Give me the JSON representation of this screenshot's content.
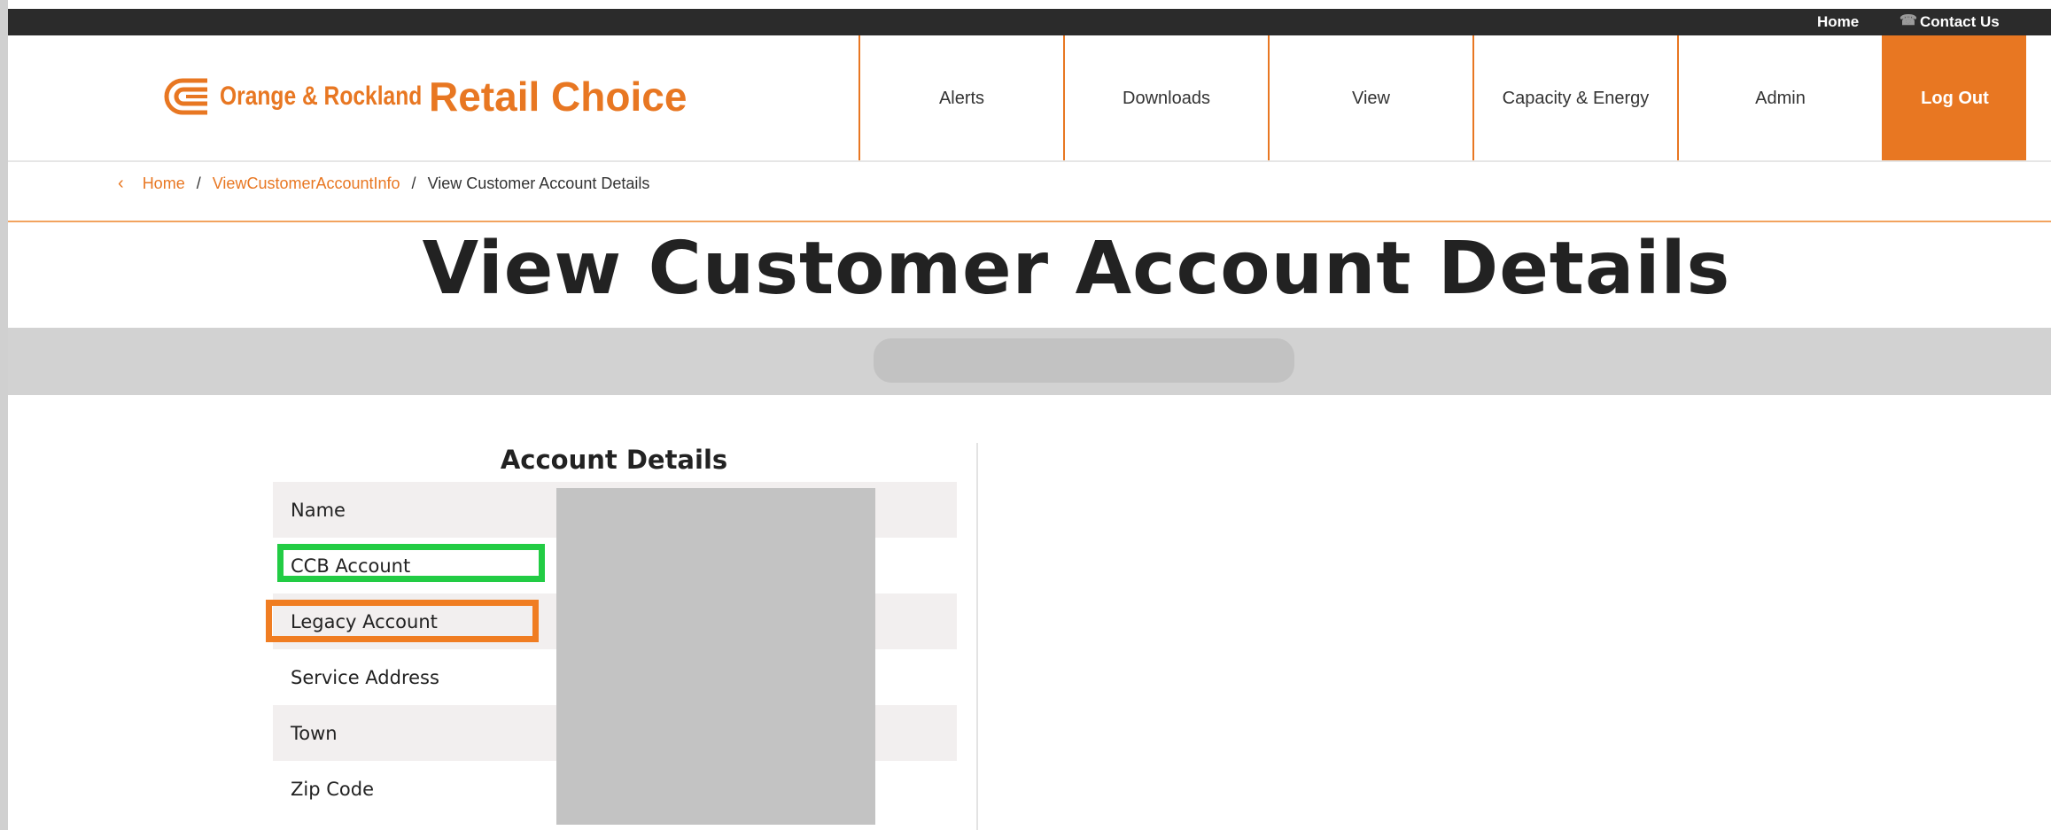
{
  "top_bar": {
    "home_label": "Home",
    "contact_label": "Contact Us"
  },
  "brand": {
    "company": "Orange & Rockland",
    "product": "Retail Choice",
    "accent_color": "#e87722"
  },
  "nav": {
    "items": [
      {
        "label": "Alerts"
      },
      {
        "label": "Downloads"
      },
      {
        "label": "View"
      },
      {
        "label": "Capacity & Energy"
      },
      {
        "label": "Admin"
      }
    ],
    "logout_label": "Log Out"
  },
  "breadcrumb": {
    "items": [
      "Home",
      "ViewCustomerAccountInfo"
    ],
    "current": "View Customer Account Details",
    "separator": "/"
  },
  "page": {
    "title": "View Customer Account Details"
  },
  "account_details": {
    "title": "Account Details",
    "fields": [
      {
        "label": "Name"
      },
      {
        "label": "CCB Account"
      },
      {
        "label": "Legacy Account"
      },
      {
        "label": "Service Address"
      },
      {
        "label": "Town"
      },
      {
        "label": "Zip Code"
      }
    ]
  },
  "annotations": {
    "green_highlight_color": "#22cc44",
    "orange_highlight_color": "#f07d22"
  }
}
